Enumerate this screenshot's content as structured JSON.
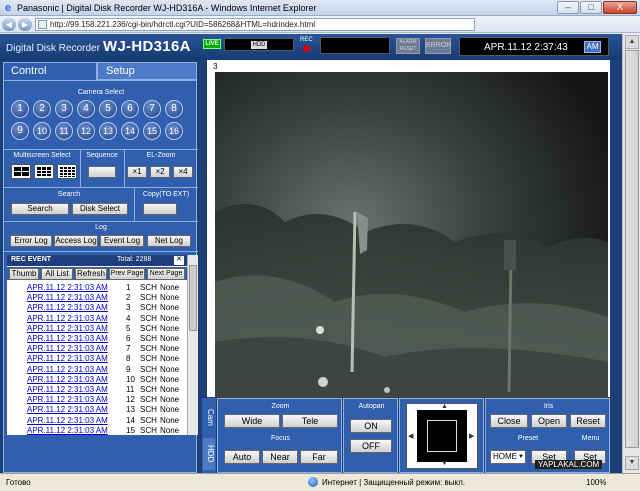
{
  "browser": {
    "title": "Panasonic | Digital Disk Recorder WJ-HD316A - Windows Internet Explorer",
    "url": "http://99.158.221.236/cgi-bin/hdrctl.cgi?UID=586268&HTML=hdrindex.html",
    "controls": {
      "minimize": "–",
      "maximize": "□",
      "close": "X"
    },
    "status_left": "Готово",
    "zone": "Интернет | Защищенный режим: выкл.",
    "zoom": "100%",
    "watermark": "YAPLAKAL.COM"
  },
  "header": {
    "brand_small": "Digital Disk Recorder",
    "brand_big": "WJ-HD316A",
    "live": "LIVE",
    "hdd": "HDD",
    "rec": "REC",
    "alarm_reset": "ALARM RESET",
    "error": "ERROR",
    "datetime": "APR.11.12   2:37:43",
    "ampm": "AM"
  },
  "tabs": {
    "control": "Control",
    "setup": "Setup"
  },
  "camera_select": {
    "title": "Camera Select",
    "cameras": [
      "1",
      "2",
      "3",
      "4",
      "5",
      "6",
      "7",
      "8",
      "9",
      "10",
      "11",
      "12",
      "13",
      "14",
      "15",
      "16"
    ]
  },
  "multiscreen": {
    "title": "Multiscreen Select"
  },
  "sequence": {
    "title": "Sequence"
  },
  "el_zoom": {
    "title": "EL-Zoom",
    "options": [
      "×1",
      "×2",
      "×4"
    ]
  },
  "search": {
    "title": "Search",
    "search_btn": "Search",
    "disk_select_btn": "Disk Select"
  },
  "copy": {
    "title": "Copy(TO EXT)"
  },
  "log": {
    "title": "Log",
    "buttons": [
      "Error Log",
      "Access Log",
      "Event Log",
      "Net Log"
    ]
  },
  "rec_event": {
    "title": "REC EVENT",
    "total": "Total: 2288",
    "close": "✕",
    "toolbar": [
      "Thumb",
      "All List",
      "Refresh",
      "Prev Page",
      "Next Page"
    ],
    "rows": [
      {
        "date": "APR.11.12 2:31:03 AM",
        "num": "1",
        "type": "SCH",
        "status": "None"
      },
      {
        "date": "APR.11.12 2:31:03 AM",
        "num": "2",
        "type": "SCH",
        "status": "None"
      },
      {
        "date": "APR.11.12 2:31:03 AM",
        "num": "3",
        "type": "SCH",
        "status": "None"
      },
      {
        "date": "APR.11.12 2:31:03 AM",
        "num": "4",
        "type": "SCH",
        "status": "None"
      },
      {
        "date": "APR.11.12 2:31:03 AM",
        "num": "5",
        "type": "SCH",
        "status": "None"
      },
      {
        "date": "APR.11.12 2:31:03 AM",
        "num": "6",
        "type": "SCH",
        "status": "None"
      },
      {
        "date": "APR.11.12 2:31:03 AM",
        "num": "7",
        "type": "SCH",
        "status": "None"
      },
      {
        "date": "APR.11.12 2:31:03 AM",
        "num": "8",
        "type": "SCH",
        "status": "None"
      },
      {
        "date": "APR.11.12 2:31:03 AM",
        "num": "9",
        "type": "SCH",
        "status": "None"
      },
      {
        "date": "APR.11.12 2:31:03 AM",
        "num": "10",
        "type": "SCH",
        "status": "None"
      },
      {
        "date": "APR.11.12 2:31:03 AM",
        "num": "11",
        "type": "SCH",
        "status": "None"
      },
      {
        "date": "APR.11.12 2:31:03 AM",
        "num": "12",
        "type": "SCH",
        "status": "None"
      },
      {
        "date": "APR.11.12 2:31:03 AM",
        "num": "13",
        "type": "SCH",
        "status": "None"
      },
      {
        "date": "APR.11.12 2:31:03 AM",
        "num": "14",
        "type": "SCH",
        "status": "None"
      },
      {
        "date": "APR.11.12 2:31:03 AM",
        "num": "15",
        "type": "SCH",
        "status": "None"
      }
    ]
  },
  "camera_view": {
    "label": "3"
  },
  "side_tabs": {
    "cam": "Cam",
    "hdd": "HDD"
  },
  "zoom": {
    "title": "Zoom",
    "wide": "Wide",
    "tele": "Tele"
  },
  "focus": {
    "title": "Focus",
    "auto": "Auto",
    "near": "Near",
    "far": "Far"
  },
  "autopan": {
    "title": "Autopan",
    "on": "ON",
    "off": "OFF"
  },
  "iris": {
    "title": "Iris",
    "close": "Close",
    "open": "Open",
    "reset": "Reset"
  },
  "preset": {
    "title": "Preset",
    "value": "HOME",
    "set": "Set"
  },
  "menu": {
    "title": "Menu",
    "set": "Set"
  }
}
